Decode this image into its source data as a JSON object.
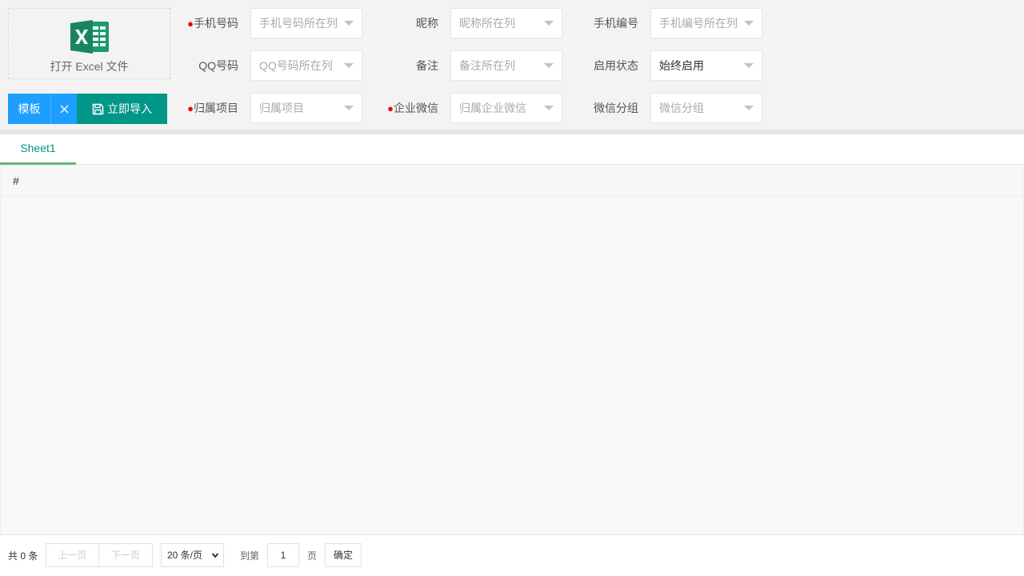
{
  "upload": {
    "label": "打开 Excel 文件",
    "icon": "excel-icon"
  },
  "buttons": {
    "template": "模板",
    "clear": "✕",
    "import": "立即导入"
  },
  "fields": {
    "phone": {
      "label": "手机号码",
      "required": true,
      "placeholder": "手机号码所在列"
    },
    "nickname": {
      "label": "昵称",
      "required": false,
      "placeholder": "昵称所在列"
    },
    "phone_no": {
      "label": "手机编号",
      "required": false,
      "placeholder": "手机编号所在列"
    },
    "qq": {
      "label": "QQ号码",
      "required": false,
      "placeholder": "QQ号码所在列"
    },
    "remark": {
      "label": "备注",
      "required": false,
      "placeholder": "备注所在列"
    },
    "status": {
      "label": "启用状态",
      "required": false,
      "value": "始终启用"
    },
    "project": {
      "label": "归属项目",
      "required": true,
      "placeholder": "归属项目"
    },
    "wecom": {
      "label": "企业微信",
      "required": true,
      "placeholder": "归属企业微信"
    },
    "wechat_group": {
      "label": "微信分组",
      "required": false,
      "placeholder": "微信分组"
    }
  },
  "tabs": [
    {
      "label": "Sheet1",
      "active": true
    }
  ],
  "grid": {
    "columns": [
      "#"
    ]
  },
  "pager": {
    "total": "共 0 条",
    "prev": "上一页",
    "next": "下一页",
    "page_size": "20 条/页",
    "goto_label": "到第",
    "page_input": "1",
    "page_suffix": "页",
    "confirm": "确定"
  },
  "colors": {
    "primary": "#1e9fff",
    "import": "#009688",
    "tab_active": "#009688",
    "tab_underline": "#5fb878",
    "required": "#ee0000",
    "excel_green": "#1a9b6f"
  }
}
